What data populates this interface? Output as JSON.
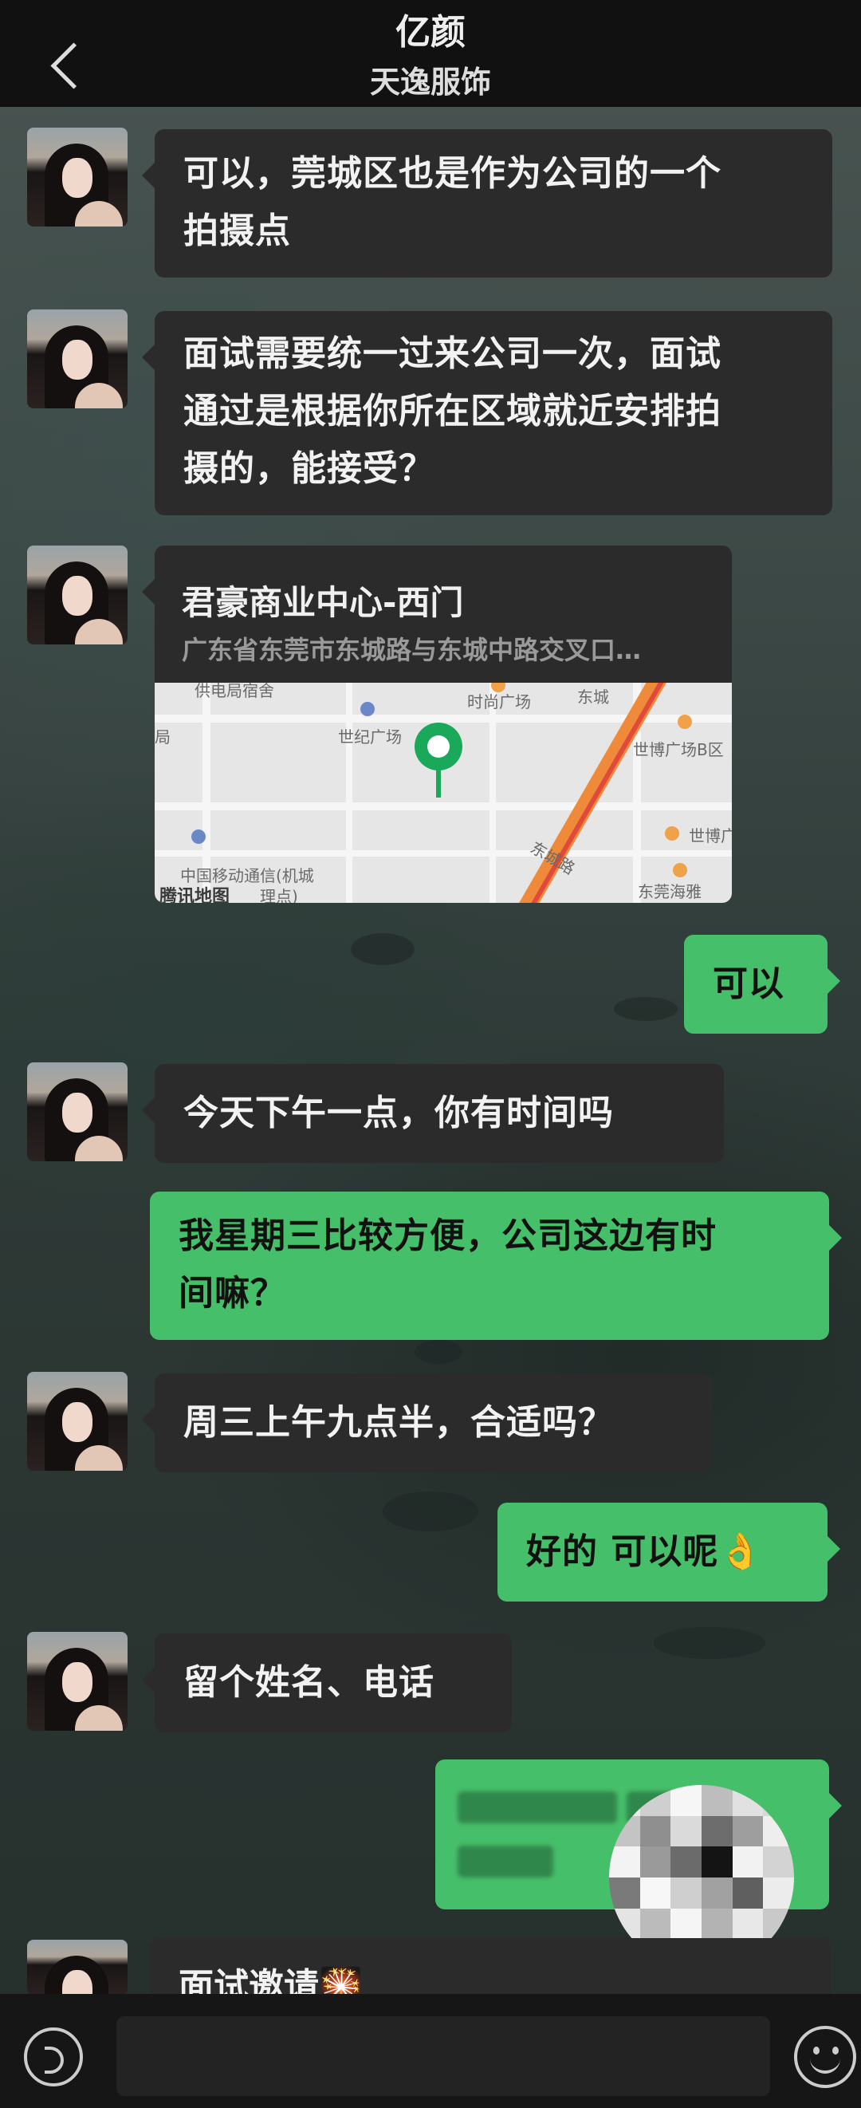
{
  "header": {
    "title": "亿颜",
    "subtitle": "天逸服饰"
  },
  "messages": [
    {
      "id": "m1",
      "direction": "in",
      "text": "可以，莞城区也是作为公司的一个拍摄点"
    },
    {
      "id": "m2",
      "direction": "in",
      "text": "面试需要统一过来公司一次，面试通过是根据你所在区域就近安排拍摄的，能接受？"
    },
    {
      "id": "m4",
      "direction": "out",
      "text": "可以"
    },
    {
      "id": "m5",
      "direction": "in",
      "text": "今天下午一点，你有时间吗"
    },
    {
      "id": "m6",
      "direction": "out",
      "text": "我星期三比较方便，公司这边有时间嘛？"
    },
    {
      "id": "m7",
      "direction": "in",
      "text": "周三上午九点半，合适吗？"
    },
    {
      "id": "m8",
      "direction": "out",
      "text": "好的 可以呢",
      "emoji": "👌"
    },
    {
      "id": "m9",
      "direction": "in",
      "text": "留个姓名、电话"
    },
    {
      "id": "m11",
      "direction": "in",
      "text": "面试邀请",
      "emoji": "🎇"
    }
  ],
  "m1_lines": [
    "可以，莞城区也是作为公司的一个",
    "拍摄点"
  ],
  "m2_lines": [
    "面试需要统一过来公司一次，面试",
    "通过是根据你所在区域就近安排拍",
    "摄的，能接受？"
  ],
  "m6_lines": [
    "我星期三比较方便，公司这边有时",
    "间嘛？"
  ],
  "location": {
    "name": "君豪商业中心-西门",
    "address": "广东省东莞市东城路与东城中路交叉口…",
    "map_labels": {
      "top_left": "供电局宿舍",
      "shishang": "时尚广场",
      "dongcheng": "东城",
      "shiji": "世纪广场",
      "shibo_b": "世博广场B区",
      "bureau": "局",
      "shibo": "世博广",
      "mobile": "中国移动通信(机城",
      "mobile2": "理点)",
      "road": "东城路",
      "dongguan": "东莞海雅",
      "logo": "腾讯地图"
    }
  },
  "colors": {
    "incoming_bubble": "#2b2b2b",
    "outgoing_bubble": "#46bf6a",
    "header_bg": "#111111",
    "bottom_bar": "#161616"
  },
  "icons": [
    "back-icon",
    "voice-icon",
    "emoji-icon"
  ]
}
